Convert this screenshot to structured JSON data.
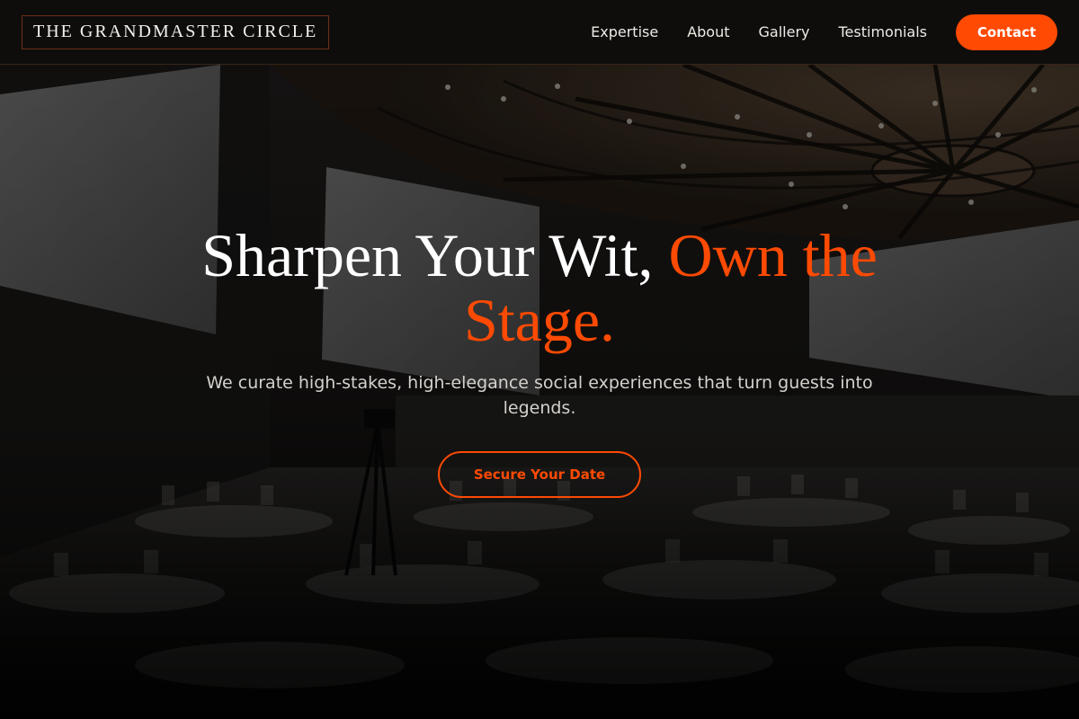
{
  "brand": {
    "name": "THE GRANDMASTER CIRCLE"
  },
  "nav": {
    "items": [
      {
        "label": "Expertise"
      },
      {
        "label": "About"
      },
      {
        "label": "Gallery"
      },
      {
        "label": "Testimonials"
      }
    ],
    "contact_label": "Contact"
  },
  "hero": {
    "headline_part1": "Sharpen Your Wit, ",
    "headline_accent": "Own the Stage.",
    "subtitle": "We curate high-stakes, high-elegance social experiences that turn guests into legends.",
    "cta_label": "Secure Your Date",
    "background": "dark-conference-hall-photo"
  },
  "colors": {
    "accent": "#fe4a03",
    "header_bg": "#100e0d",
    "text": "#ffffff",
    "muted_text": "#d4d1cc"
  }
}
